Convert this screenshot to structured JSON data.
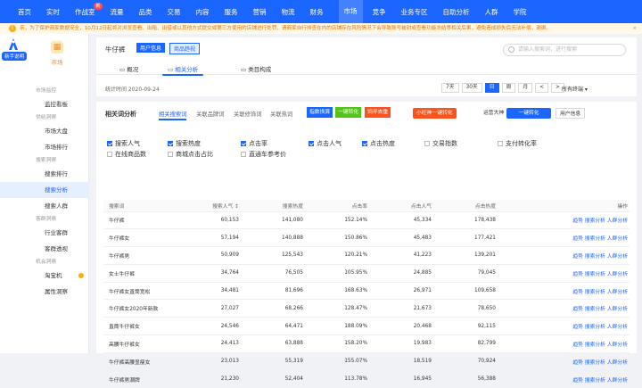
{
  "topnav": {
    "items": [
      "首页",
      "实时",
      "作战室",
      "流量",
      "品类",
      "交易",
      "内容",
      "服务",
      "营销",
      "物流",
      "财务",
      "市场",
      "竞争",
      "业务专区",
      "自助分析",
      "人群",
      "学院"
    ],
    "active_index": 11,
    "badge": "新"
  },
  "notice": {
    "text": "亲，为了保护商家数据安全，10月12日起将对浏览查看、出租、出借或以其他方式提交或第三方使用的店铺进行处罚，请商家自行排查在内的店铺存在风险情况下会导致账号被封或查看功能冻结等相关后果，避免造成损失后无法补偿，谢谢。"
  },
  "sidebar": {
    "promo_tag": "新手说明",
    "module_label": "市场",
    "sections": [
      {
        "header": "市场监控",
        "items": [
          "监控看板"
        ]
      },
      {
        "header": "供给洞察",
        "items": [
          "市场大盘",
          "市场排行"
        ]
      },
      {
        "header": "搜索洞察",
        "items": [
          "搜索排行",
          "搜索分析",
          "搜索人群"
        ]
      },
      {
        "header": "客群洞察",
        "items": [
          "行业客群",
          "客群透视"
        ]
      },
      {
        "header": "机会洞察",
        "items": [
          "淘宝机",
          "属性洞察"
        ]
      }
    ],
    "active_item": "搜索分析"
  },
  "header": {
    "product": "牛仔裤",
    "tag_user": "用户信息",
    "tag_goods": "商品趋视",
    "search_placeholder": "请输入搜索词，进行搜索",
    "tabs": [
      "概况",
      "相关分析",
      "类目构成"
    ],
    "active_tab": 1,
    "stats_time_label": "统计时间 2020-09-24",
    "date_buttons": [
      "7天",
      "30天",
      "日",
      "周",
      "月",
      "<",
      ">"
    ],
    "active_date": "日",
    "terminal": "所有终端"
  },
  "analysis": {
    "title": "相关词分析",
    "subtabs": [
      "相关搜索词",
      "关联品牌词",
      "关联修饰词",
      "关联热词"
    ],
    "active_subtab": 0,
    "chips": [
      {
        "label": "指数换算",
        "color": "#1a66ff"
      },
      {
        "label": "一键转化",
        "color": "#52c41a"
      },
      {
        "label": "饲寻去重",
        "color": "#fa541c"
      }
    ],
    "xiaowang_btn": "小旺神一键转化",
    "indicator_label": "运营大神",
    "one_click_btn": "一键转化",
    "user_info_btn": "用户信息",
    "checkboxes": [
      {
        "label": "搜索人气",
        "on": true
      },
      {
        "label": "搜索热度",
        "on": true
      },
      {
        "label": "点击率",
        "on": true
      },
      {
        "label": "点击人气",
        "on": true
      },
      {
        "label": "点击热度",
        "on": true
      },
      {
        "label": "交易指数",
        "on": false
      },
      {
        "label": "支付转化率",
        "on": false
      },
      {
        "label": "在线商品数",
        "on": false
      },
      {
        "label": "商城点击占比",
        "on": false
      },
      {
        "label": "直通车参考价",
        "on": false
      }
    ]
  },
  "table": {
    "columns": [
      "搜索词",
      "搜索人气 ↕",
      "搜索热度",
      "点击率",
      "点击人气",
      "点击热度",
      "操作"
    ],
    "rows": [
      [
        "牛仔裤",
        "60,153",
        "141,080",
        "152.14%",
        "45,334",
        "178,438"
      ],
      [
        "牛仔裤女",
        "57,194",
        "140,888",
        "150.86%",
        "45,483",
        "177,421"
      ],
      [
        "牛仔裤男",
        "50,909",
        "125,543",
        "120.21%",
        "41,223",
        "139,201"
      ],
      [
        "女士牛仔裤",
        "34,764",
        "76,505",
        "105.95%",
        "24,885",
        "79,045"
      ],
      [
        "牛仔裤女直筒宽松",
        "34,481",
        "81,696",
        "168.63%",
        "26,971",
        "109,658"
      ],
      [
        "牛仔裤女2020年新款",
        "27,027",
        "68,266",
        "128.47%",
        "21,673",
        "78,650"
      ],
      [
        "直筒牛仔裤女",
        "24,546",
        "64,471",
        "188.09%",
        "20,468",
        "92,115"
      ],
      [
        "高腰牛仔裤女",
        "24,413",
        "63,888",
        "158.20%",
        "19,983",
        "82,799"
      ],
      [
        "牛仔裤高腰显瘦女",
        "23,013",
        "55,319",
        "155.07%",
        "18,519",
        "70,924"
      ],
      [
        "牛仔裤男潮牌",
        "21,230",
        "52,404",
        "113.78%",
        "16,945",
        "56,388"
      ]
    ],
    "ops": "趋势 搜索分析 人群分析"
  }
}
